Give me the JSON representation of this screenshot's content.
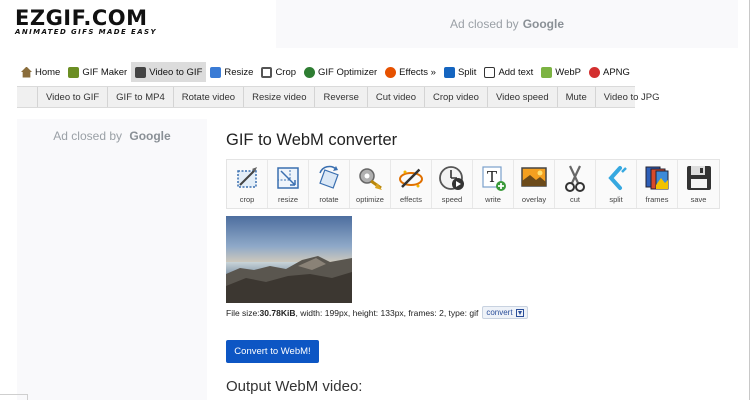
{
  "logo": {
    "name": "EZGIF.COM",
    "tagline": "ANIMATED GIFS MADE EASY"
  },
  "ads": {
    "top": {
      "text": "Ad closed by",
      "brand": "Google"
    },
    "side": {
      "text": "Ad closed by",
      "brand": "Google"
    }
  },
  "nav": {
    "items": [
      {
        "label": "Home",
        "icon": "home-icon",
        "color": "#8a6d3b"
      },
      {
        "label": "GIF Maker",
        "icon": "gif-maker-icon",
        "color": "#6b8e23"
      },
      {
        "label": "Video to GIF",
        "icon": "video-to-gif-icon",
        "color": "#444444",
        "active": true
      },
      {
        "label": "Resize",
        "icon": "resize-icon",
        "color": "#3a7bd5"
      },
      {
        "label": "Crop",
        "icon": "crop-icon",
        "color": "#555555"
      },
      {
        "label": "GIF Optimizer",
        "icon": "optimizer-icon",
        "color": "#2e7d32"
      },
      {
        "label": "Effects »",
        "icon": "effects-icon",
        "color": "#e65100"
      },
      {
        "label": "Split",
        "icon": "split-icon",
        "color": "#1565c0"
      },
      {
        "label": "Add text",
        "icon": "add-text-icon",
        "color": "#333333"
      },
      {
        "label": "WebP",
        "icon": "webp-icon",
        "color": "#7cb342"
      },
      {
        "label": "APNG",
        "icon": "apng-icon",
        "color": "#d32f2f"
      }
    ]
  },
  "subnav": {
    "icon": "film-icon",
    "items": [
      "Video to GIF",
      "GIF to MP4",
      "Rotate video",
      "Resize video",
      "Reverse",
      "Cut video",
      "Crop video",
      "Video speed",
      "Mute",
      "Video to JPG"
    ]
  },
  "main": {
    "title": "GIF to WebM converter",
    "tools": [
      {
        "label": "crop",
        "icon": "crop-tool-icon"
      },
      {
        "label": "resize",
        "icon": "resize-tool-icon"
      },
      {
        "label": "rotate",
        "icon": "rotate-tool-icon"
      },
      {
        "label": "optimize",
        "icon": "optimize-tool-icon"
      },
      {
        "label": "effects",
        "icon": "effects-tool-icon"
      },
      {
        "label": "speed",
        "icon": "speed-tool-icon"
      },
      {
        "label": "write",
        "icon": "write-tool-icon"
      },
      {
        "label": "overlay",
        "icon": "overlay-tool-icon"
      },
      {
        "label": "cut",
        "icon": "cut-tool-icon"
      },
      {
        "label": "split",
        "icon": "split-tool-icon"
      },
      {
        "label": "frames",
        "icon": "frames-tool-icon"
      },
      {
        "label": "save",
        "icon": "save-tool-icon"
      }
    ],
    "file_info": {
      "prefix": "File size: ",
      "size": "30.78KiB",
      "details": ", width: 199px, height: 133px, frames: 2, type: gif",
      "convert_label": "convert"
    },
    "convert_button": "Convert to WebM!",
    "output_title": "Output WebM video:"
  }
}
